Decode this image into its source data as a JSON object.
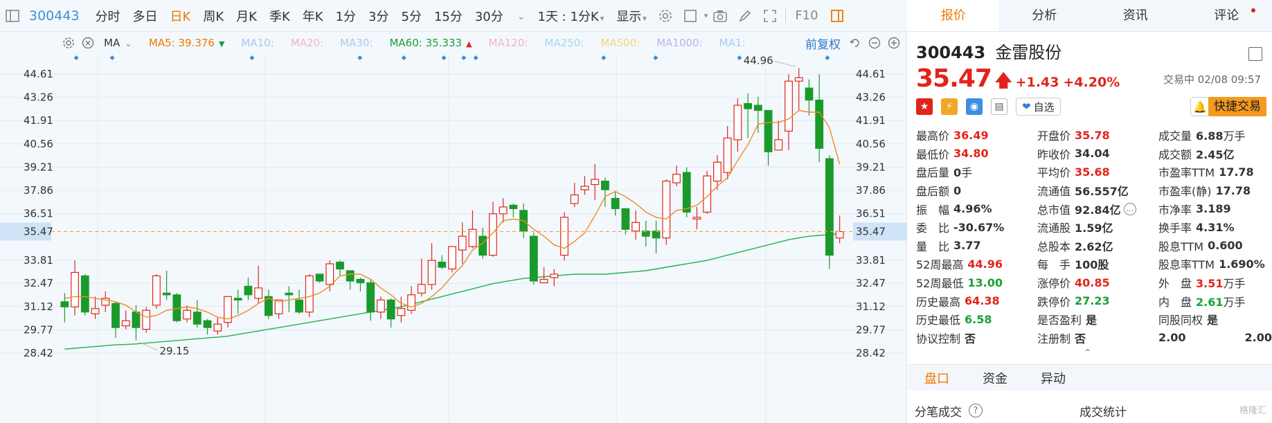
{
  "toolbar": {
    "code": "300443",
    "items": [
      "分时",
      "多日",
      "日K",
      "周K",
      "月K",
      "季K",
      "年K",
      "1分",
      "3分",
      "5分",
      "15分",
      "30分"
    ],
    "active_index": 2,
    "range_label": "1天 : 1分K",
    "display_label": "显示",
    "f10_label": "F10"
  },
  "ma_bar": {
    "ma_label": "MA",
    "fuquan_label": "前复权",
    "items": [
      {
        "text": "MA5: 39.376",
        "color": "#f07800",
        "arrow": "down"
      },
      {
        "text": "MA10:",
        "color": "#a9cbe8"
      },
      {
        "text": "MA20:",
        "color": "#f2b2cc"
      },
      {
        "text": "MA30:",
        "color": "#a9cbe8"
      },
      {
        "text": "MA60: 35.333",
        "color": "#1aa035",
        "arrow": "up"
      },
      {
        "text": "MA120:",
        "color": "#f2b2cc"
      },
      {
        "text": "MA250:",
        "color": "#a6d8ee"
      },
      {
        "text": "MA500:",
        "color": "#f3d57a"
      },
      {
        "text": "MA1000:",
        "color": "#c2b0e6"
      },
      {
        "text": "MA1:",
        "color": "#a9cbe8"
      }
    ]
  },
  "axis": {
    "ticks": [
      "44.61",
      "43.26",
      "41.91",
      "40.56",
      "39.21",
      "37.86",
      "36.51",
      "35.47",
      "33.81",
      "32.47",
      "31.12",
      "29.77",
      "28.42"
    ],
    "current_price_label": "35.47"
  },
  "chart_data": {
    "type": "candlestick",
    "y_range": [
      28.42,
      45.3
    ],
    "high_label": "44.96",
    "low_label": "29.15",
    "current_price": 35.47,
    "colors": {
      "up": "#e2231a",
      "down": "#1a9a2b",
      "ma5": "#f08a24",
      "ma60": "#22b14c",
      "price_line": "#f5a04a"
    },
    "candles": [
      [
        31.4,
        31.1,
        31.9,
        30.2
      ],
      [
        31.1,
        33.1,
        33.8,
        30.6
      ],
      [
        32.9,
        30.8,
        33.0,
        30.6
      ],
      [
        30.7,
        31.0,
        31.7,
        30.4
      ],
      [
        31.2,
        31.6,
        32.0,
        30.8
      ],
      [
        31.3,
        29.9,
        31.4,
        29.3
      ],
      [
        30.0,
        30.3,
        30.9,
        29.8
      ],
      [
        30.8,
        29.9,
        31.2,
        29.15
      ],
      [
        29.8,
        30.9,
        31.1,
        29.6
      ],
      [
        31.2,
        32.9,
        33.0,
        31.0
      ],
      [
        31.9,
        31.8,
        33.2,
        31.5
      ],
      [
        31.8,
        30.3,
        31.9,
        30.2
      ],
      [
        30.4,
        30.9,
        31.2,
        30.2
      ],
      [
        30.8,
        30.1,
        31.5,
        29.9
      ],
      [
        30.3,
        29.9,
        30.4,
        29.5
      ],
      [
        29.7,
        30.1,
        30.5,
        29.5
      ],
      [
        30.2,
        31.7,
        31.7,
        29.9
      ],
      [
        31.6,
        31.5,
        32.1,
        30.7
      ],
      [
        32.3,
        31.8,
        32.8,
        31.5
      ],
      [
        31.6,
        32.2,
        33.5,
        31.3
      ],
      [
        31.7,
        30.6,
        32.1,
        30.4
      ],
      [
        30.7,
        31.5,
        31.5,
        30.4
      ],
      [
        31.9,
        31.8,
        32.3,
        30.8
      ],
      [
        31.5,
        30.8,
        32.1,
        30.7
      ],
      [
        30.8,
        32.9,
        33.0,
        30.5
      ],
      [
        33.0,
        32.6,
        32.9,
        32.5
      ],
      [
        32.4,
        33.6,
        33.8,
        32.0
      ],
      [
        33.7,
        33.3,
        33.8,
        32.9
      ],
      [
        33.2,
        32.6,
        33.2,
        32.1
      ],
      [
        32.7,
        32.5,
        32.8,
        32.0
      ],
      [
        32.5,
        30.8,
        32.7,
        30.3
      ],
      [
        30.8,
        31.5,
        31.7,
        30.4
      ],
      [
        31.5,
        30.4,
        31.6,
        29.9
      ],
      [
        30.6,
        31.0,
        31.7,
        30.2
      ],
      [
        30.9,
        31.8,
        32.3,
        30.7
      ],
      [
        31.9,
        32.4,
        33.9,
        31.7
      ],
      [
        32.4,
        33.8,
        34.8,
        32.1
      ],
      [
        33.7,
        33.4,
        34.1,
        33.3
      ],
      [
        33.3,
        34.6,
        34.6,
        33.1
      ],
      [
        34.4,
        35.2,
        36.0,
        33.6
      ],
      [
        34.6,
        35.6,
        36.7,
        34.5
      ],
      [
        35.2,
        34.1,
        35.7,
        33.9
      ],
      [
        34.1,
        36.5,
        37.2,
        34.0
      ],
      [
        36.5,
        36.9,
        37.4,
        36.0
      ],
      [
        37.0,
        36.8,
        37.1,
        36.3
      ],
      [
        36.7,
        35.5,
        37.1,
        35.1
      ],
      [
        35.2,
        32.6,
        35.4,
        32.4
      ],
      [
        32.5,
        32.7,
        33.4,
        32.5
      ],
      [
        32.8,
        33.0,
        33.3,
        32.3
      ],
      [
        34.1,
        36.3,
        36.6,
        33.8
      ],
      [
        37.1,
        37.6,
        38.3,
        36.9
      ],
      [
        37.9,
        38.1,
        38.7,
        37.6
      ],
      [
        38.2,
        38.5,
        39.4,
        37.3
      ],
      [
        38.4,
        37.9,
        38.6,
        36.9
      ],
      [
        37.4,
        36.8,
        37.8,
        36.4
      ],
      [
        36.8,
        35.6,
        36.8,
        35.3
      ],
      [
        35.5,
        36.0,
        36.7,
        35.0
      ],
      [
        35.5,
        35.2,
        36.1,
        34.6
      ],
      [
        35.5,
        35.1,
        36.1,
        34.2
      ],
      [
        35.1,
        38.4,
        38.5,
        34.7
      ],
      [
        38.3,
        38.8,
        39.3,
        38.1
      ],
      [
        38.9,
        36.6,
        39.2,
        36.3
      ],
      [
        36.2,
        36.3,
        36.9,
        35.6
      ],
      [
        36.6,
        38.7,
        39.0,
        36.5
      ],
      [
        38.4,
        39.5,
        39.9,
        37.9
      ],
      [
        38.9,
        40.9,
        41.6,
        38.5
      ],
      [
        40.8,
        42.8,
        43.2,
        40.1
      ],
      [
        42.9,
        42.6,
        43.5,
        40.9
      ],
      [
        42.8,
        42.5,
        43.3,
        41.2
      ],
      [
        42.5,
        40.1,
        42.5,
        39.3
      ],
      [
        40.2,
        40.8,
        41.9,
        40.2
      ],
      [
        41.3,
        44.2,
        44.6,
        40.2
      ],
      [
        44.2,
        44.4,
        44.96,
        42.5
      ],
      [
        43.8,
        43.1,
        44.3,
        42.2
      ],
      [
        43.1,
        40.3,
        44.6,
        39.5
      ],
      [
        39.7,
        34.1,
        39.9,
        33.3
      ],
      [
        35.1,
        35.47,
        36.4,
        34.8
      ]
    ],
    "ma5": [
      31.6,
      31.7,
      31.7,
      31.6,
      31.5,
      31.4,
      31.2,
      30.8,
      30.5,
      30.6,
      30.9,
      31.0,
      31.1,
      31.0,
      30.8,
      30.5,
      30.4,
      30.6,
      30.9,
      31.3,
      31.6,
      31.4,
      31.5,
      31.6,
      31.7,
      31.9,
      32.3,
      32.9,
      33.0,
      33.0,
      32.7,
      32.2,
      31.8,
      31.3,
      31.1,
      31.3,
      31.7,
      32.2,
      32.9,
      33.5,
      34.4,
      34.8,
      35.4,
      36.1,
      36.2,
      36.1,
      35.6,
      35.2,
      34.7,
      34.5,
      34.9,
      35.4,
      36.4,
      37.5,
      37.8,
      37.5,
      37.1,
      36.6,
      36.3,
      36.2,
      36.7,
      36.8,
      37.0,
      37.5,
      38.1,
      38.6,
      39.6,
      40.5,
      41.7,
      41.8,
      41.8,
      42.0,
      42.5,
      42.4,
      42.4,
      41.5,
      39.376
    ],
    "ma60": [
      28.65,
      28.7,
      28.75,
      28.8,
      28.85,
      28.9,
      28.92,
      28.95,
      29.0,
      29.05,
      29.1,
      29.15,
      29.2,
      29.25,
      29.3,
      29.35,
      29.4,
      29.5,
      29.6,
      29.7,
      29.8,
      29.9,
      30.0,
      30.1,
      30.2,
      30.3,
      30.4,
      30.5,
      30.6,
      30.7,
      30.8,
      30.9,
      31.0,
      31.1,
      31.25,
      31.4,
      31.55,
      31.7,
      31.85,
      32.0,
      32.15,
      32.3,
      32.45,
      32.55,
      32.65,
      32.75,
      32.8,
      32.85,
      32.9,
      32.95,
      33.0,
      33.0,
      33.0,
      33.0,
      33.05,
      33.1,
      33.15,
      33.2,
      33.3,
      33.4,
      33.5,
      33.6,
      33.7,
      33.8,
      33.95,
      34.1,
      34.25,
      34.4,
      34.55,
      34.7,
      34.85,
      35.0,
      35.1,
      35.2,
      35.25,
      35.3,
      35.333
    ],
    "markers": [
      0.03,
      0.075,
      0.25,
      0.385,
      0.44,
      0.49,
      0.515,
      0.53,
      0.69,
      0.755,
      0.86,
      0.97
    ]
  },
  "quote": {
    "code": "300443",
    "name": "金雷股份",
    "price": "35.47",
    "change": "+1.43",
    "pct": "+4.20%",
    "status": "交易中 02/08 09:57",
    "watch_label": "自选",
    "fast_trade_label": "快捷交易",
    "rows": [
      [
        {
          "l": "最高价",
          "v": "36.49",
          "c": "red"
        },
        {
          "l": "开盘价",
          "v": "35.78",
          "c": "red"
        },
        {
          "l": "成交量",
          "v": "6.88",
          "u": "万手"
        }
      ],
      [
        {
          "l": "最低价",
          "v": "34.80",
          "c": "red"
        },
        {
          "l": "昨收价",
          "v": "34.04"
        },
        {
          "l": "成交额",
          "v": "2.45亿"
        }
      ],
      [
        {
          "l": "盘后量",
          "v": "0",
          "u": "手"
        },
        {
          "l": "平均价",
          "v": "35.68",
          "c": "red"
        },
        {
          "l": "市盈率TTM",
          "v": "17.78"
        }
      ],
      [
        {
          "l": "盘后额",
          "v": "0"
        },
        {
          "l": "流通值",
          "v": "56.557亿"
        },
        {
          "l": "市盈率(静)",
          "v": "17.78"
        }
      ],
      [
        {
          "l": "振　幅",
          "v": "4.96%"
        },
        {
          "l": "总市值",
          "v": "92.84亿"
        },
        {
          "l": "市净率",
          "v": "3.189"
        }
      ],
      [
        {
          "l": "委　比",
          "v": "-30.67%"
        },
        {
          "l": "流通股",
          "v": "1.59亿"
        },
        {
          "l": "换手率",
          "v": "4.31%"
        }
      ],
      [
        {
          "l": "量　比",
          "v": "3.77"
        },
        {
          "l": "总股本",
          "v": "2.62亿"
        },
        {
          "l": "股息TTM",
          "v": "0.600"
        }
      ],
      [
        {
          "l": "52周最高",
          "v": "44.96",
          "c": "red"
        },
        {
          "l": "每　手",
          "v": "100股"
        },
        {
          "l": "股息率TTM",
          "v": "1.690%"
        }
      ],
      [
        {
          "l": "52周最低",
          "v": "13.00",
          "c": "green"
        },
        {
          "l": "涨停价",
          "v": "40.85",
          "c": "red"
        },
        {
          "l": "外　盘",
          "v": "3.51",
          "u": "万手",
          "c": "red"
        }
      ],
      [
        {
          "l": "历史最高",
          "v": "64.38",
          "c": "red"
        },
        {
          "l": "跌停价",
          "v": "27.23",
          "c": "green"
        },
        {
          "l": "内　盘",
          "v": "2.61",
          "u": "万手",
          "c": "green"
        }
      ],
      [
        {
          "l": "历史最低",
          "v": "6.58",
          "c": "green"
        },
        {
          "l": "是否盈利",
          "v": "是"
        },
        {
          "l": "同股同权",
          "v": "是"
        }
      ],
      [
        {
          "l": "协议控制",
          "v": "否"
        },
        {
          "l": "注册制",
          "v": "否"
        },
        {
          "l": "2.00",
          "v": "2.00"
        }
      ]
    ]
  },
  "right_tabs": [
    "报价",
    "分析",
    "资讯",
    "评论"
  ],
  "sub_tabs": [
    "盘口",
    "资金",
    "异动"
  ],
  "bottom": {
    "left": "分笔成交",
    "center": "成交统计"
  },
  "watermark": "格隆汇"
}
